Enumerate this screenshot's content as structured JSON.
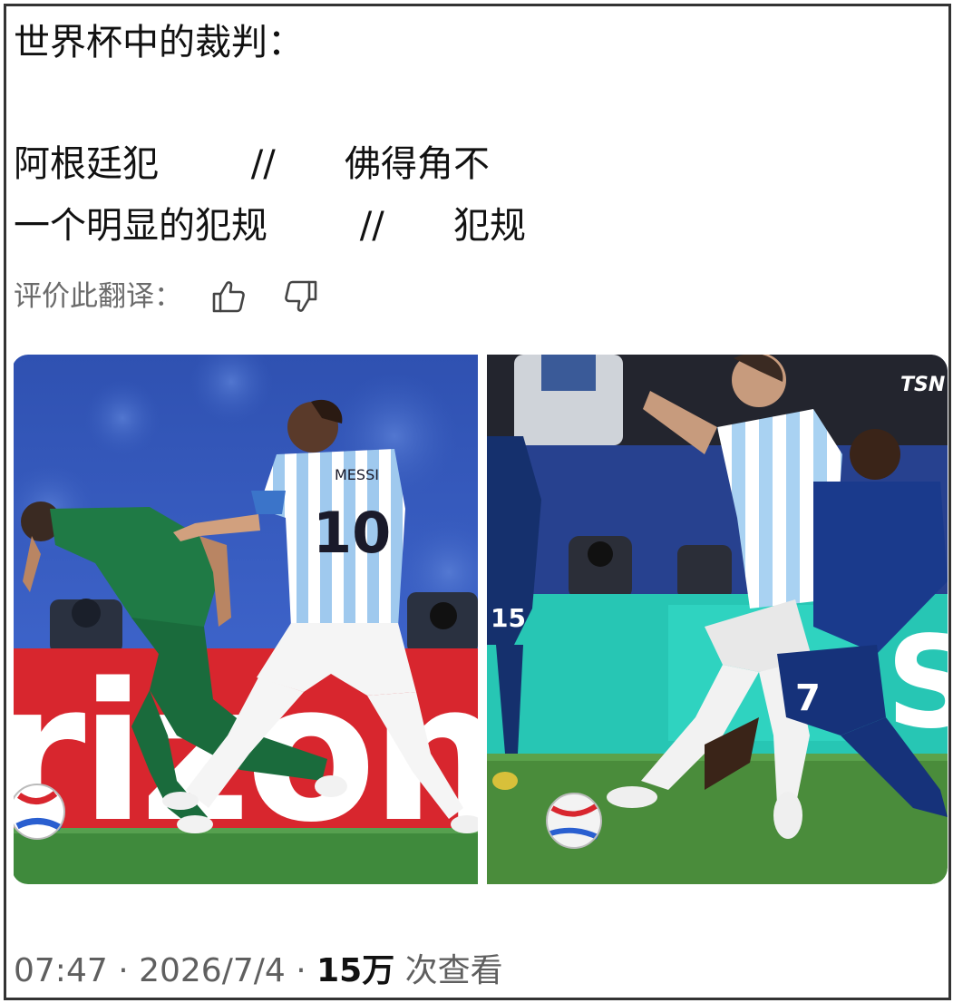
{
  "post": {
    "line1": "世界杯中的裁判：",
    "line2": "阿根廷犯        //      佛得角不",
    "line3": "一个明显的犯规        //      犯规"
  },
  "translation_rating": {
    "label": "评价此翻译：",
    "thumb_up_icon": "thumbs-up-icon",
    "thumb_down_icon": "thumbs-down-icon"
  },
  "media": {
    "left_photo": {
      "subject": "Argentina player in light-blue/white striped jersey number 10 fouling green-jersey opponent",
      "jersey_name": "MESSI",
      "jersey_number": "10",
      "ad_board_text": "rizon"
    },
    "right_photo": {
      "subject": "Argentina player with ball being challenged by dark-blue jersey player number 7",
      "broadcast_logo": "TSN",
      "opponent_numbers": [
        "15",
        "7"
      ]
    }
  },
  "meta": {
    "time": "07:47",
    "separator1": " · ",
    "date": "2026/7/4",
    "separator2": " · ",
    "views_count": "15万",
    "views_label": " 次查看"
  },
  "colors": {
    "text": "#111111",
    "muted": "#6b6b6b",
    "border": "#333333",
    "pitch_green": "#3f8a3c",
    "ad_red": "#d8262e"
  }
}
